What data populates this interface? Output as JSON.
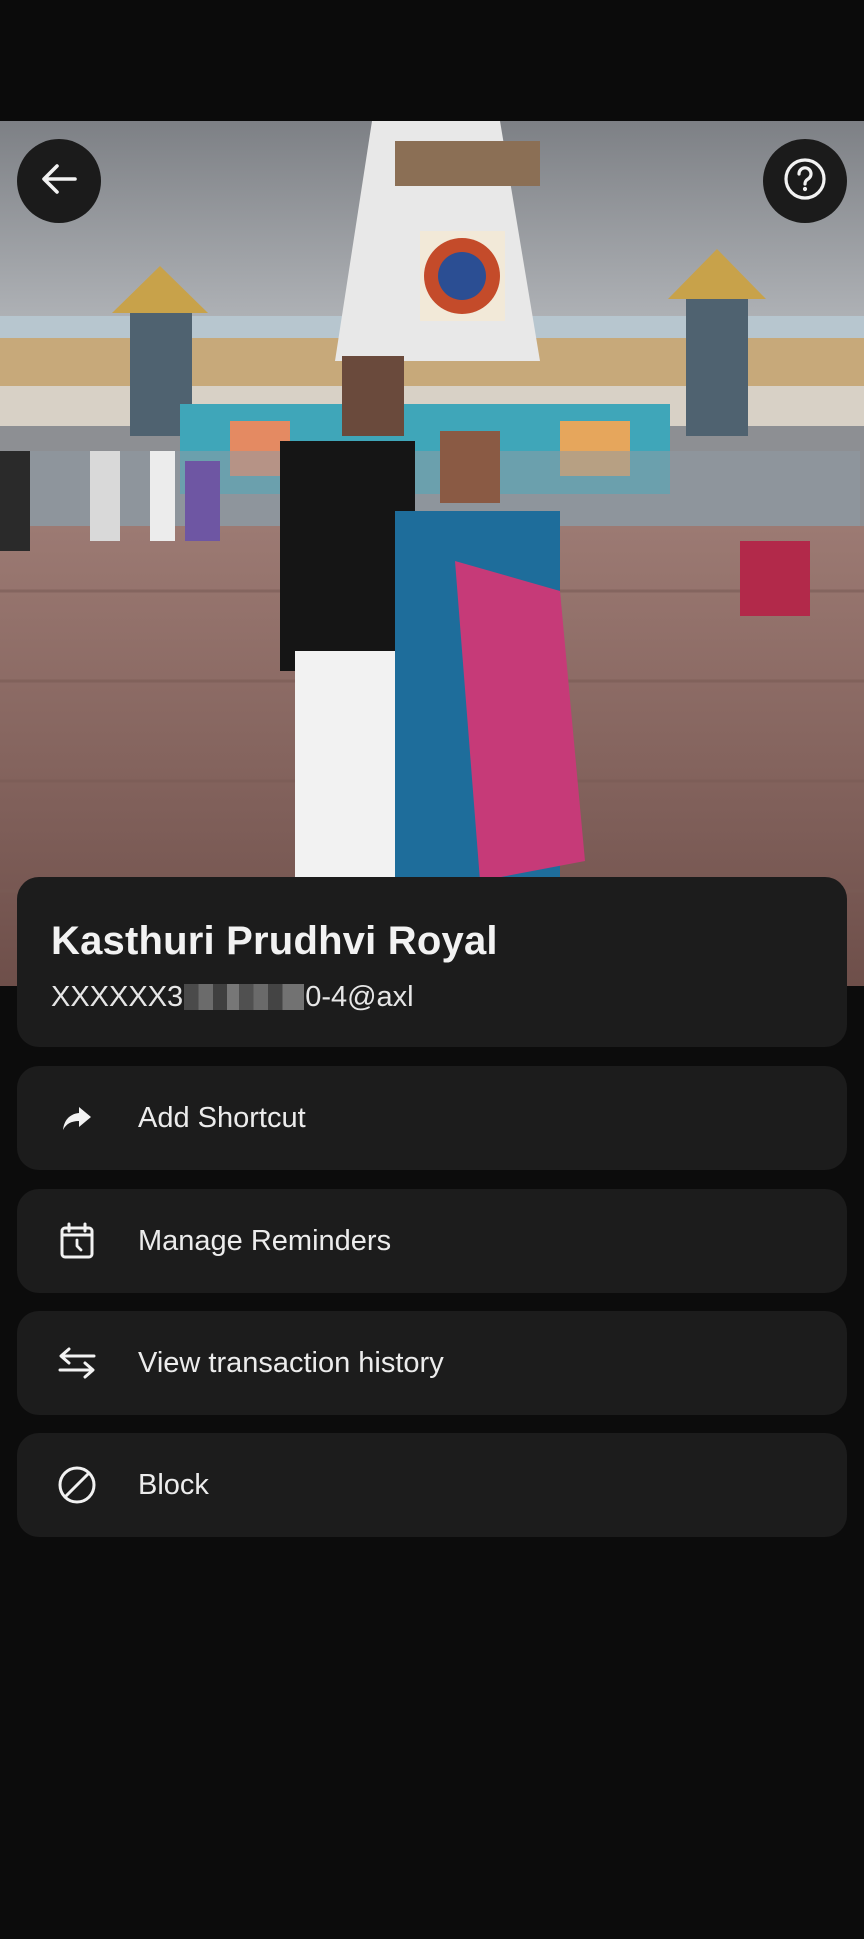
{
  "profile": {
    "name": "Kasthuri Prudhvi Royal",
    "upi_prefix": "XXXXXX3",
    "upi_suffix": "0-4@axl"
  },
  "actions": [
    {
      "label": "Add Shortcut",
      "icon": "share-arrow-icon"
    },
    {
      "label": "Manage Reminders",
      "icon": "calendar-clock-icon"
    },
    {
      "label": "View transaction history",
      "icon": "swap-arrows-icon"
    },
    {
      "label": "Block",
      "icon": "block-icon"
    }
  ],
  "header": {
    "back_icon": "back-arrow-icon",
    "help_icon": "help-icon"
  }
}
